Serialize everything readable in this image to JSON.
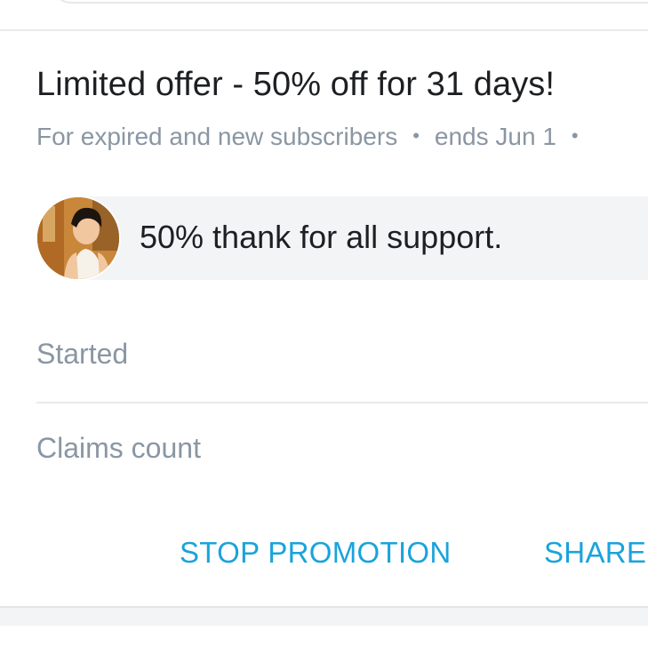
{
  "promotion": {
    "title": "Limited offer - 50% off for 31 days!",
    "audience": "For expired and new subscribers",
    "separator": "•",
    "ends": "ends Jun 1",
    "trailing_separator": "•",
    "message": "50% thank for all support."
  },
  "fields": {
    "started_label": "Started",
    "claims_count_label": "Claims count"
  },
  "actions": {
    "stop_label": "STOP PROMOTION",
    "share_label": "SHARE"
  },
  "colors": {
    "accent": "#1aa3db",
    "primary_text": "#1d1f22",
    "secondary_text": "#8a96a3",
    "bubble_bg": "#f3f4f6",
    "divider": "#e8eaed"
  }
}
